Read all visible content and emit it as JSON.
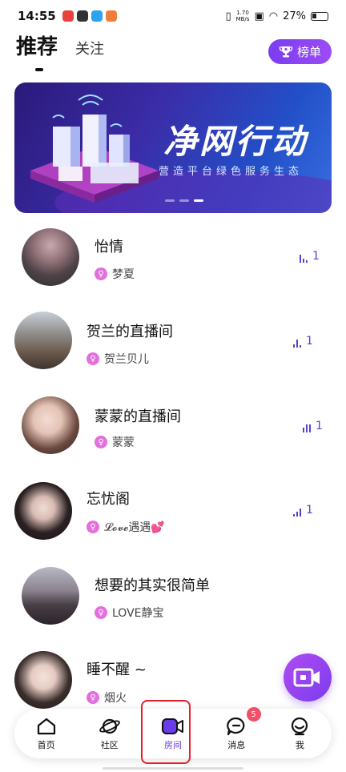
{
  "status_bar": {
    "time": "14:55",
    "net_speed_value": "1.70",
    "net_speed_unit": "MB/s",
    "battery": "27%"
  },
  "top_tabs": {
    "recommend": "推荐",
    "follow": "关注",
    "rank_label": "榜单"
  },
  "banner": {
    "title": "净网行动",
    "subtitle": "营造平台绿色服务生态",
    "slide_count": 3,
    "active_slide": 3
  },
  "rooms": [
    {
      "name": "怡情",
      "host": "梦夏",
      "count": "1"
    },
    {
      "name": "贺兰的直播间",
      "host": "贺兰贝儿",
      "count": "1"
    },
    {
      "name": "蒙蒙的直播间",
      "host": "蒙蒙",
      "count": "1"
    },
    {
      "name": "忘忧阁",
      "host": "𝓛𝓸𝓿𝓮遇遇💕",
      "count": "1"
    },
    {
      "name": "想要的其实很简单",
      "host": "LOVE静宝",
      "count": ""
    },
    {
      "name": "睡不醒 ~",
      "host": "烟火",
      "count": ""
    }
  ],
  "bottom_nav": {
    "items": [
      {
        "label": "首页",
        "icon": "home-icon"
      },
      {
        "label": "社区",
        "icon": "planet-icon"
      },
      {
        "label": "房间",
        "icon": "video-room-icon"
      },
      {
        "label": "消息",
        "icon": "message-icon",
        "badge": "5"
      },
      {
        "label": "我",
        "icon": "profile-icon"
      }
    ],
    "active_index": 2
  },
  "colors": {
    "accent": "#6a3be8",
    "badge": "#f0506a",
    "highlight": "#e3202a"
  }
}
